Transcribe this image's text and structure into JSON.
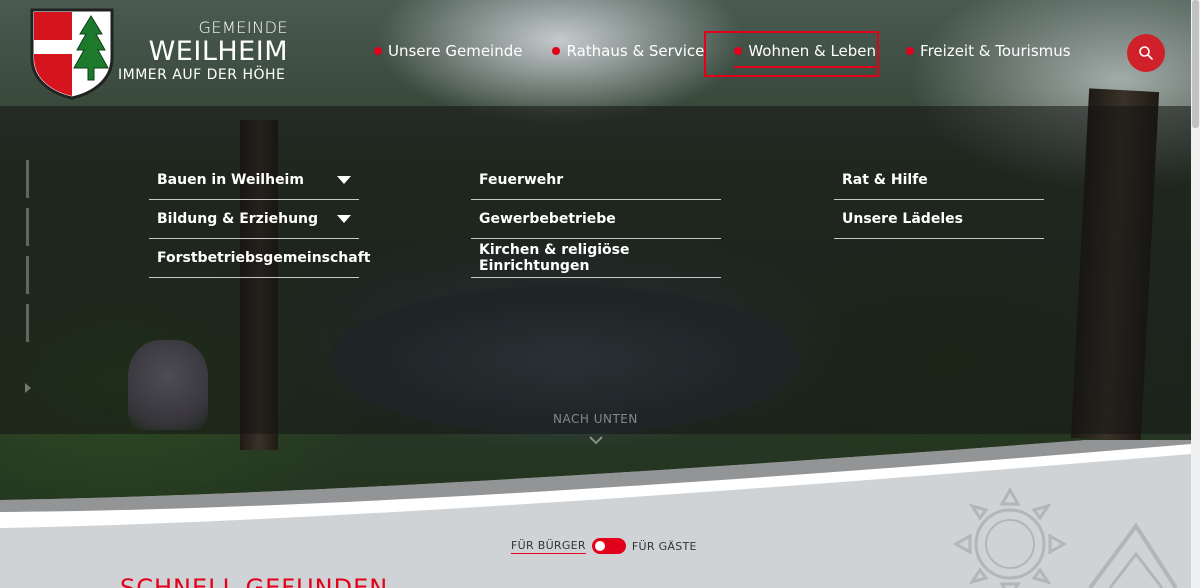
{
  "logo": {
    "small": "GEMEINDE",
    "big": "WEILHEIM",
    "tagline": "IMMER AUF DER HÖHE"
  },
  "nav": [
    {
      "label": "Unsere Gemeinde"
    },
    {
      "label": "Rathaus & Service"
    },
    {
      "label": "Wohnen & Leben"
    },
    {
      "label": "Freizeit & Tourismus"
    }
  ],
  "mega_menu": {
    "col1": [
      {
        "label": "Bauen in Weilheim"
      },
      {
        "label": "Bildung & Erziehung"
      },
      {
        "label": "Forstbetriebsgemeinschaft"
      }
    ],
    "col2": [
      {
        "label": "Feuerwehr"
      },
      {
        "label": "Gewerbebetriebe"
      },
      {
        "label": "Kirchen & religiöse Einrichtungen"
      }
    ],
    "col3": [
      {
        "label": "Rat & Hilfe"
      },
      {
        "label": "Unsere Lädeles"
      }
    ]
  },
  "hero": {
    "scroll_label": "NACH UNTEN"
  },
  "audience_toggle": {
    "left": "FÜR BÜRGER",
    "right": "FÜR GÄSTE"
  },
  "section_title": "SCHNELL GEFUNDEN",
  "colors": {
    "accent": "#e2001a"
  }
}
